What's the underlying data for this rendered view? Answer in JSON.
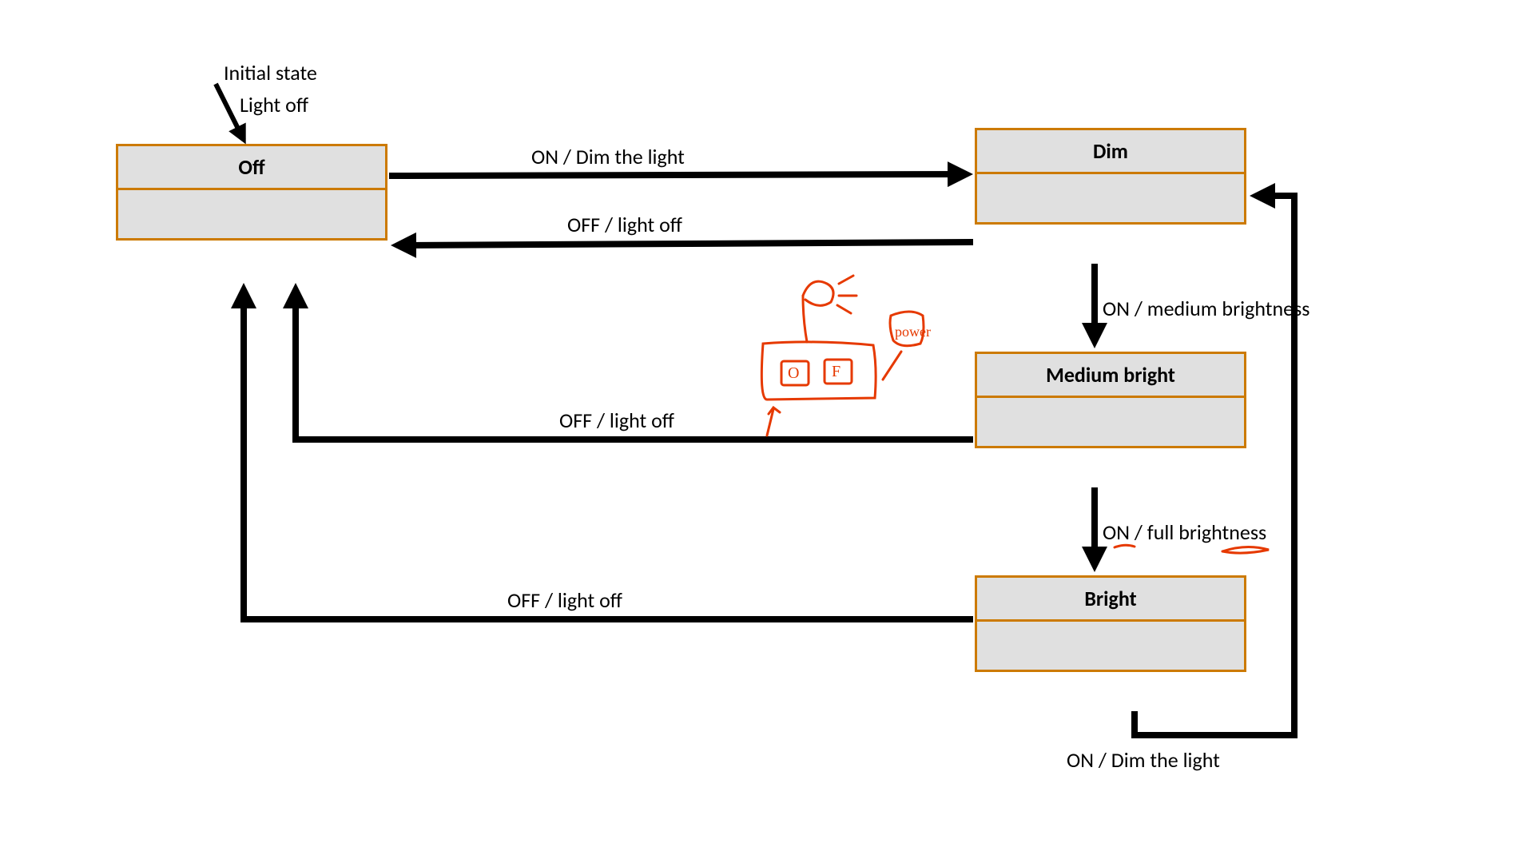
{
  "annotation": {
    "initial_state": "Initial state",
    "light_off": "Light off"
  },
  "states": {
    "off": "Off",
    "dim": "Dim",
    "medium": "Medium bright",
    "bright": "Bright"
  },
  "transitions": {
    "off_to_dim": "ON / Dim the light",
    "dim_to_off": "OFF / light off",
    "dim_to_medium": "ON / medium brightness",
    "medium_to_off": "OFF / light off",
    "medium_to_bright": "ON / full brightness",
    "bright_to_off": "OFF / light off",
    "bright_to_dim": "ON / Dim the light"
  },
  "sketch": {
    "power": "power",
    "o": "O",
    "f": "F"
  },
  "colors": {
    "state_border": "#cc7a00",
    "state_fill": "#e0e0e0",
    "arrow": "#000000",
    "sketch": "#e63900"
  }
}
